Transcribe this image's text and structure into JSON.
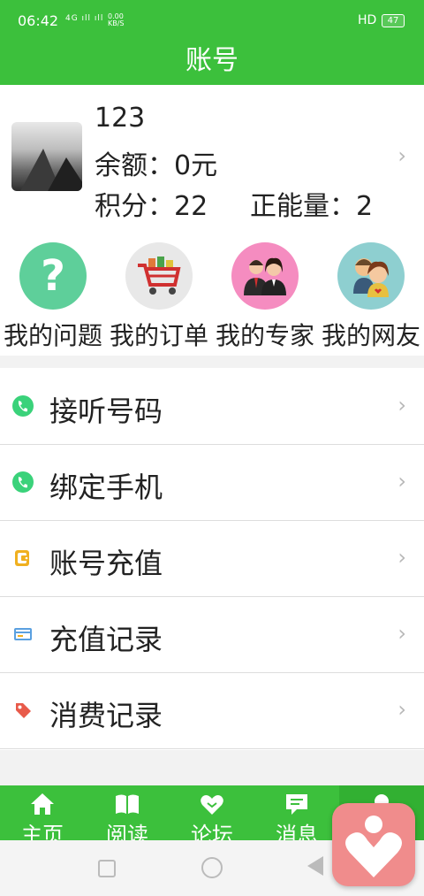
{
  "status_bar": {
    "time": "06:42",
    "signal": "4G ıll ıll",
    "net_speed": "0.00",
    "net_unit": "KB/S",
    "network_type": "HD",
    "battery": "47"
  },
  "header": {
    "title": "账号"
  },
  "profile": {
    "name": "123",
    "balance": "余额：0元",
    "points": "积分：22",
    "energy": "正能量：2"
  },
  "shortcuts": [
    {
      "label": "我的问题",
      "icon": "question-icon",
      "color": "#5ecf9a"
    },
    {
      "label": "我的订单",
      "icon": "shopping-cart-icon",
      "color": "#e8e8e8"
    },
    {
      "label": "我的专家",
      "icon": "experts-icon",
      "color": "#f58cc0"
    },
    {
      "label": "我的网友",
      "icon": "friends-icon",
      "color": "#8ecfd0"
    }
  ],
  "menu": [
    {
      "label": "接听号码",
      "icon": "phone-icon"
    },
    {
      "label": "绑定手机",
      "icon": "phone-icon"
    },
    {
      "label": "账号充值",
      "icon": "wallet-icon"
    },
    {
      "label": "充值记录",
      "icon": "card-icon"
    },
    {
      "label": "消费记录",
      "icon": "tag-icon"
    }
  ],
  "tabs": [
    {
      "label": "主页",
      "icon": "home-icon"
    },
    {
      "label": "阅读",
      "icon": "book-icon"
    },
    {
      "label": "论坛",
      "icon": "heart-hands-icon"
    },
    {
      "label": "消息",
      "icon": "message-icon"
    },
    {
      "label": "",
      "icon": "bell-icon"
    }
  ],
  "colors": {
    "primary": "#3cc03c",
    "floating_button": "#f08c8c",
    "chevron": "#b8b8b8"
  }
}
